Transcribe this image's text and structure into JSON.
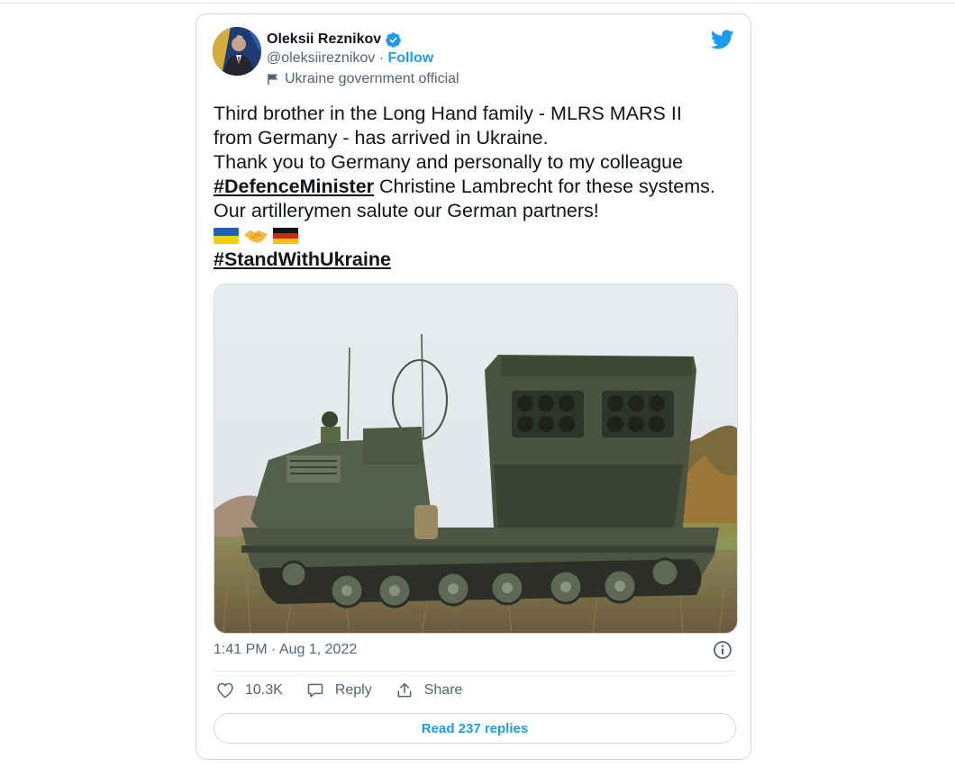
{
  "author": {
    "name": "Oleksii Reznikov",
    "handle": "@oleksiireznikov",
    "separator": " · ",
    "follow_label": "Follow",
    "label": "Ukraine government official"
  },
  "tweet": {
    "line1": "Third brother in the Long Hand family - MLRS MARS II",
    "line2": "from Germany - has arrived in Ukraine.",
    "line3": "Thank you to Germany and personally to my colleague",
    "hashtag1": "#DefenceMinister",
    "line4_rest": " Christine Lambrecht for these systems.",
    "line5": "Our artillerymen salute our German partners!",
    "emojis": [
      "flag-ukraine",
      "handshake",
      "flag-germany"
    ],
    "hashtag2": "#StandWithUkraine"
  },
  "timestamp": "1:41 PM · Aug 1, 2022",
  "actions": {
    "likes": "10.3K",
    "reply_label": "Reply",
    "share_label": "Share"
  },
  "read_replies_label": "Read 237 replies",
  "colors": {
    "accent": "#1d9bf0",
    "text_secondary": "#536471",
    "border": "#cfd9de"
  }
}
